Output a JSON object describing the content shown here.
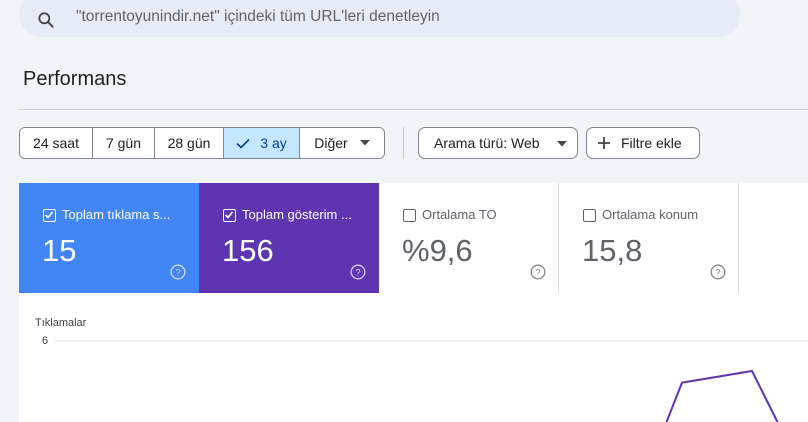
{
  "search": {
    "text": "\"torrentoyunindir.net\" içindeki tüm URL'leri denetleyin"
  },
  "page_title": "Performans",
  "date_range": {
    "options": [
      {
        "label": "24 saat",
        "active": false
      },
      {
        "label": "7 gün",
        "active": false
      },
      {
        "label": "28 gün",
        "active": false
      },
      {
        "label": "3 ay",
        "active": true
      },
      {
        "label": "Diğer",
        "active": false
      }
    ]
  },
  "filters": {
    "search_type_label": "Arama türü: Web",
    "add_filter_label": "Filtre ekle"
  },
  "metrics": [
    {
      "label": "Toplam tıklama s...",
      "value": "15",
      "checked": true,
      "color": "#4285f4"
    },
    {
      "label": "Toplam gösterim ...",
      "value": "156",
      "checked": true,
      "color": "#5e35b1"
    },
    {
      "label": "Ortalama TO",
      "value": "%9,6",
      "checked": false,
      "color": "#ffffff"
    },
    {
      "label": "Ortalama konum",
      "value": "15,8",
      "checked": false,
      "color": "#ffffff"
    }
  ],
  "chart_data": {
    "type": "line",
    "ylabel": "Tıklamalar",
    "y_ticks": [
      "6"
    ],
    "series": [
      {
        "color": "#5e35b1",
        "values": [
          0,
          3.5,
          4.2,
          0
        ]
      }
    ]
  }
}
